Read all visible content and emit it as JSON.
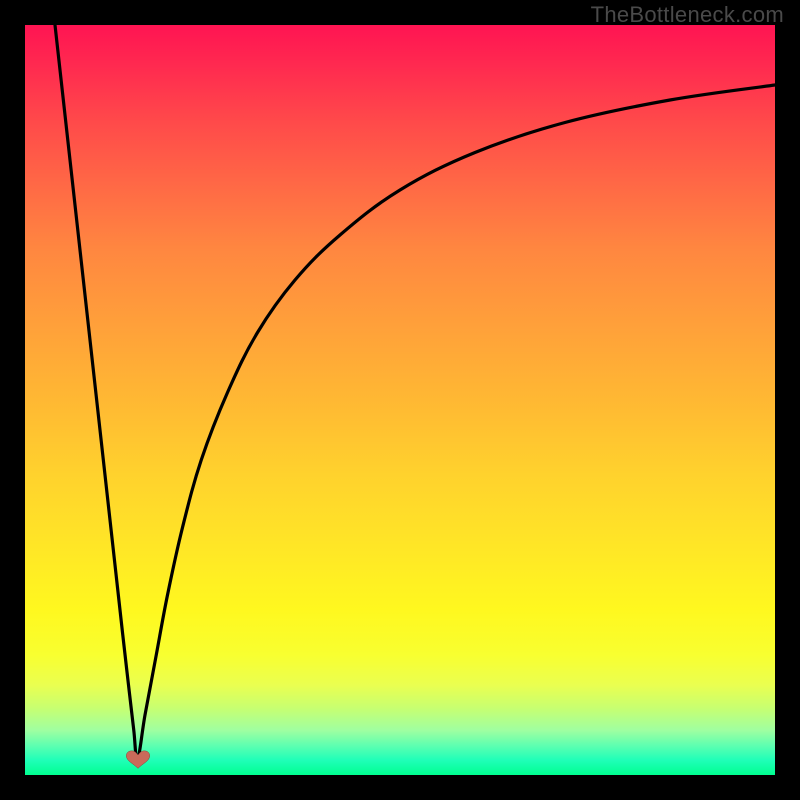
{
  "watermark": "TheBottleneck.com",
  "colors": {
    "frame": "#000000",
    "curve": "#000000",
    "marker": "#c96a5a",
    "watermark_text": "#4a4a4a"
  },
  "chart_data": {
    "type": "line",
    "title": "",
    "xlabel": "",
    "ylabel": "",
    "xlim": [
      0,
      100
    ],
    "ylim": [
      0,
      100
    ],
    "grid": false,
    "legend": false,
    "annotations": [
      {
        "kind": "marker",
        "shape": "heart",
        "x": 15,
        "y": 2
      }
    ],
    "gradient_stops": [
      {
        "pos": 0,
        "color": "#ff1452"
      },
      {
        "pos": 50,
        "color": "#ffb833"
      },
      {
        "pos": 80,
        "color": "#fff81f"
      },
      {
        "pos": 100,
        "color": "#00ff90"
      }
    ],
    "series": [
      {
        "name": "left_branch",
        "x": [
          4.0,
          5.0,
          6.0,
          7.0,
          8.0,
          9.0,
          10.0,
          11.0,
          12.0,
          13.0,
          13.8,
          14.5,
          15.0
        ],
        "y": [
          100,
          91,
          82,
          73,
          64,
          55,
          46,
          37,
          28,
          19,
          12,
          6,
          2
        ]
      },
      {
        "name": "right_branch",
        "x": [
          15.0,
          16.0,
          17.5,
          19.0,
          21.0,
          23.5,
          27.0,
          31.0,
          36.0,
          42.0,
          50.0,
          60.0,
          72.0,
          86.0,
          100.0
        ],
        "y": [
          2,
          8,
          16,
          24,
          33,
          42,
          51,
          59,
          66,
          72,
          78,
          83,
          87,
          90,
          92
        ]
      }
    ],
    "minimum": {
      "x": 15,
      "y": 2
    }
  }
}
